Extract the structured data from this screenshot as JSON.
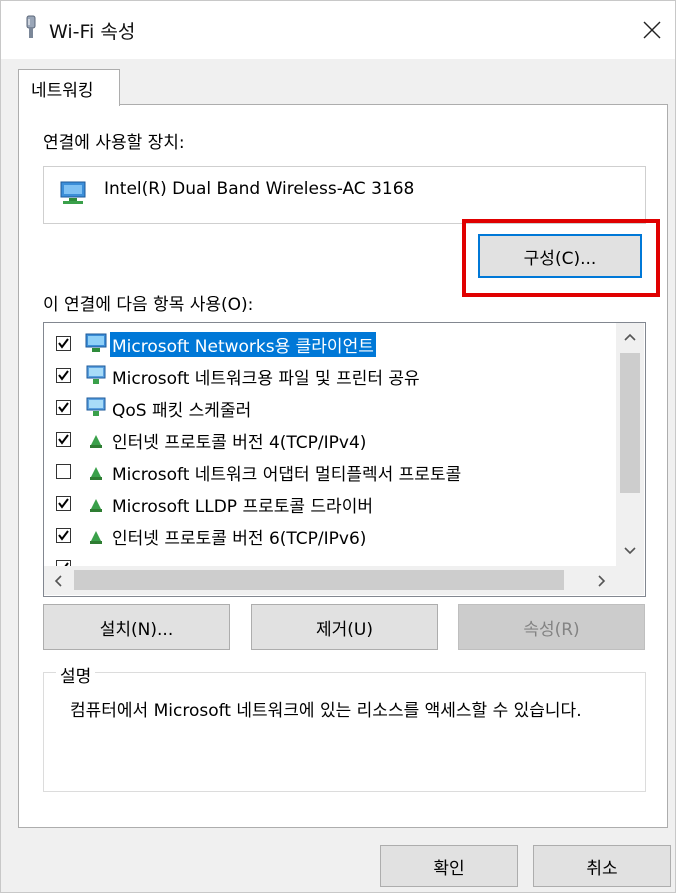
{
  "window": {
    "title": "Wi-Fi 속성",
    "close_icon": "close-icon"
  },
  "tabs": [
    {
      "label": "네트워킹"
    }
  ],
  "device": {
    "label": "연결에 사용할 장치:",
    "name": "Intel(R) Dual Band Wireless-AC 3168",
    "icon": "network-adapter-icon"
  },
  "configure_button": "구성(C)...",
  "items_label": "이 연결에 다음 항목 사용(O):",
  "items": [
    {
      "label": "Microsoft Networks용 클라이언트",
      "checked": true,
      "selected": true,
      "icon": "network-client-icon"
    },
    {
      "label": "Microsoft 네트워크용 파일 및 프린터 공유",
      "checked": true,
      "selected": false,
      "icon": "network-service-icon"
    },
    {
      "label": "QoS 패킷 스케줄러",
      "checked": true,
      "selected": false,
      "icon": "network-service-icon"
    },
    {
      "label": "인터넷 프로토콜 버전 4(TCP/IPv4)",
      "checked": true,
      "selected": false,
      "icon": "protocol-icon"
    },
    {
      "label": "Microsoft 네트워크 어댑터 멀티플렉서 프로토콜",
      "checked": false,
      "selected": false,
      "icon": "protocol-icon"
    },
    {
      "label": "Microsoft LLDP 프로토콜 드라이버",
      "checked": true,
      "selected": false,
      "icon": "protocol-icon"
    },
    {
      "label": "인터넷 프로토콜 버전 6(TCP/IPv6)",
      "checked": true,
      "selected": false,
      "icon": "protocol-icon"
    }
  ],
  "buttons": {
    "install": "설치(N)...",
    "uninstall": "제거(U)",
    "properties": "속성(R)"
  },
  "description": {
    "title": "설명",
    "text": "컴퓨터에서 Microsoft 네트워크에 있는 리소스를 액세스할 수 있습니다."
  },
  "footer": {
    "ok": "확인",
    "cancel": "취소"
  },
  "colors": {
    "selection": "#0078d7",
    "highlight_box": "#e00000"
  }
}
